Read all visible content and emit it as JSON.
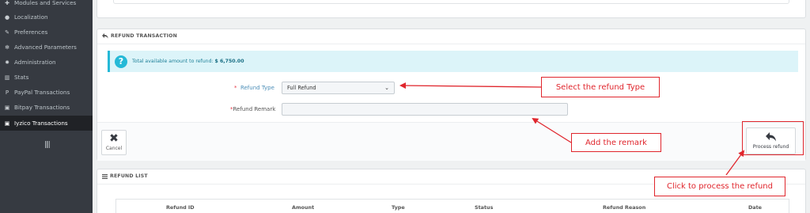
{
  "sidebar": {
    "items": [
      {
        "label": "Modules and Services",
        "icon": "puzzle-icon",
        "glyph": "✚"
      },
      {
        "label": "Localization",
        "icon": "globe-icon",
        "glyph": "●"
      },
      {
        "label": "Preferences",
        "icon": "wrench-icon",
        "glyph": "✎"
      },
      {
        "label": "Advanced Parameters",
        "icon": "cogs-icon",
        "glyph": "✻"
      },
      {
        "label": "Administration",
        "icon": "gear-icon",
        "glyph": "✹"
      },
      {
        "label": "Stats",
        "icon": "bar-chart-icon",
        "glyph": "▥"
      },
      {
        "label": "PayPal Transactions",
        "icon": "paypal-icon",
        "glyph": "P"
      },
      {
        "label": "Bitpay Transactions",
        "icon": "money-icon",
        "glyph": "▣"
      },
      {
        "label": "Iyzico Transactions",
        "icon": "money-icon",
        "glyph": "▣"
      }
    ],
    "active_index": 8
  },
  "refund_panel": {
    "title": "REFUND TRANSACTION",
    "alert_text": "Total available amount to refund:",
    "alert_amount": "$ 6,750.00",
    "refund_type_label": "Refund Type",
    "refund_type_value": "Full Refund",
    "refund_remark_label": "Refund Remark",
    "refund_remark_value": "",
    "cancel_label": "Cancel",
    "process_label": "Process refund"
  },
  "refund_list": {
    "title": "REFUND LIST",
    "columns": [
      "Refund ID",
      "Amount",
      "Type",
      "Status",
      "Refund Reason",
      "Date"
    ]
  },
  "annotations": {
    "select_type": "Select the refund Type",
    "add_remark": "Add the remark",
    "click_process": "Click to process the refund"
  },
  "colors": {
    "sidebar_bg": "#363a41",
    "alert_bg": "#dcf4f9",
    "accent": "#25b9d7",
    "annotation_red": "#e0262d"
  }
}
